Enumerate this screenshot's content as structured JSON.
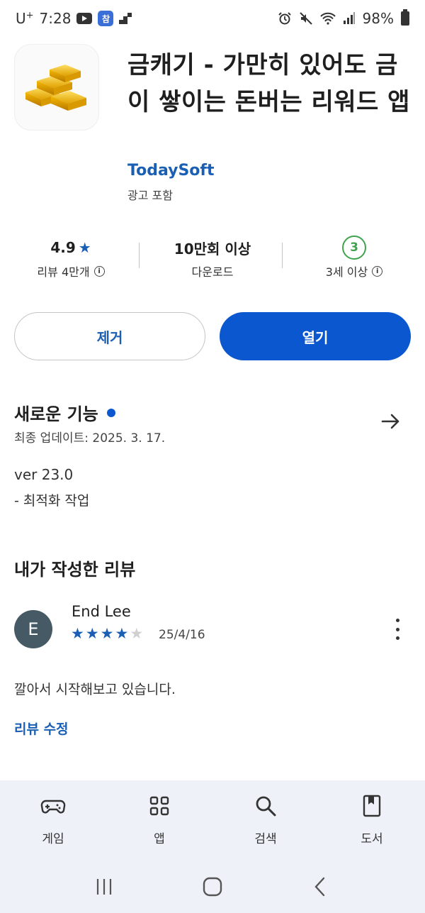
{
  "status_bar": {
    "carrier": "U",
    "carrier_sup": "+",
    "time": "7:28",
    "badge": "참",
    "battery": "98%",
    "icons": [
      "youtube-icon",
      "app-badge-icon",
      "stair-icon",
      "alarm-icon",
      "mute-icon",
      "wifi-icon",
      "signal-icon",
      "battery-icon"
    ]
  },
  "app": {
    "title": "금캐기 - 가만히 있어도 금이 쌓이는 돈버는 리워드 앱",
    "developer": "TodaySoft",
    "ads_note": "광고 포함",
    "icon": "gold-bars-icon"
  },
  "stats": {
    "rating": "4.9",
    "rating_label": "리뷰 4만개",
    "downloads": "10만회 이상",
    "downloads_label": "다운로드",
    "age_rating": "3",
    "age_label": "3세 이상"
  },
  "buttons": {
    "uninstall": "제거",
    "open": "열기"
  },
  "whats_new": {
    "title": "새로운 기능",
    "updated": "최종 업데이트: 2025. 3. 17.",
    "version": "ver 23.0",
    "note": "- 최적화 작업"
  },
  "my_review": {
    "title": "내가 작성한 리뷰",
    "avatar_letter": "E",
    "name": "End Lee",
    "stars": 4,
    "max_stars": 5,
    "date": "25/4/16",
    "text": "깔아서 시작해보고 있습니다.",
    "edit_label": "리뷰 수정"
  },
  "bottom_nav": [
    {
      "label": "게임",
      "icon": "gamepad-icon"
    },
    {
      "label": "앱",
      "icon": "apps-grid-icon"
    },
    {
      "label": "검색",
      "icon": "search-icon"
    },
    {
      "label": "도서",
      "icon": "book-icon"
    }
  ],
  "colors": {
    "accent": "#0b57d0",
    "link": "#1a5fb4",
    "age_green": "#3fa34d",
    "nav_bg": "#eef2f8"
  }
}
